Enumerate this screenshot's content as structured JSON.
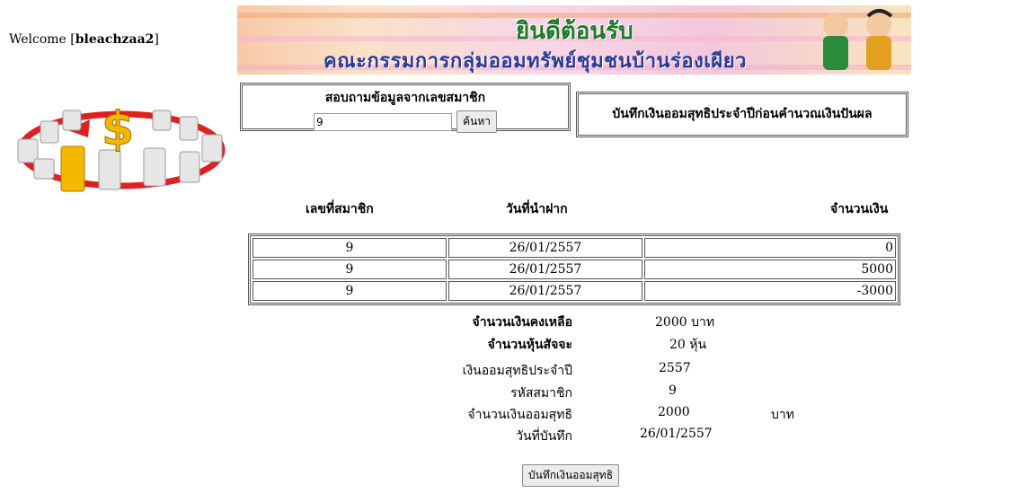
{
  "welcome": {
    "prefix": "Welcome [",
    "username": "bleachzaa2",
    "suffix": "]"
  },
  "banner": {
    "title": "ยินดีต้อนรับ",
    "subtitle": "คณะกรรมการกลุ่มออมทรัพย์ชุมชนบ้านร่องเผียว"
  },
  "search": {
    "label": "สอบถามข้อมูลจากเลขสมาชิก",
    "value": "9",
    "button": "ค้นหา"
  },
  "record_title": "บันทึกเงินออมสุทธิประจำปีก่อนคำนวณเงินปันผล",
  "table": {
    "headers": [
      "เลขที่สมาชิก",
      "วันที่นำฝาก",
      "จำนวนเงิน"
    ],
    "rows": [
      [
        "9",
        "26/01/2557",
        "0"
      ],
      [
        "9",
        "26/01/2557",
        "5000"
      ],
      [
        "9",
        "26/01/2557",
        "-3000"
      ]
    ]
  },
  "summary": {
    "balance_label": "จำนวนเงินคงเหลือ",
    "balance_value": "2000 บาท",
    "shares_label": "จำนวนหุ้นสัจจะ",
    "shares_value": "20 หุ้น"
  },
  "net": {
    "year_label": "เงินออมสุทธิประจำปี",
    "year_value": "2557",
    "member_label": "รหัสสมาชิก",
    "member_value": "9",
    "amount_label": "จำนวนเงินออมสุทธิ",
    "amount_value": "2000",
    "amount_unit": "บาท",
    "date_label": "วันที่บันทึก",
    "date_value": "26/01/2557"
  },
  "save_button": "บันทึกเงินออมสุทธิ"
}
